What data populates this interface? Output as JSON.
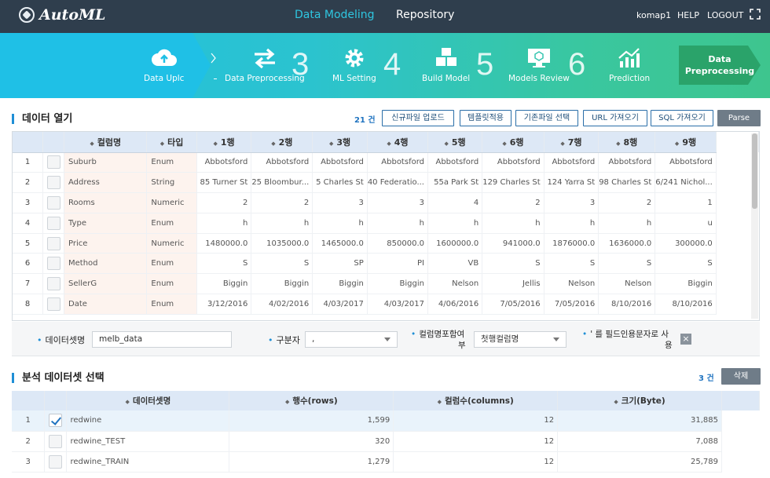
{
  "app": {
    "title": "AutoML"
  },
  "topnav": {
    "active": "Data Modeling",
    "repository": "Repository"
  },
  "user": {
    "name": "komap1",
    "help": "HELP",
    "logout": "LOGOUT"
  },
  "steps": [
    {
      "label": "Data Uplc",
      "num": ""
    },
    {
      "label": "Data Preprocessing",
      "num": "3"
    },
    {
      "label": "ML Setting",
      "num": "4"
    },
    {
      "label": "Build Model",
      "num": "5"
    },
    {
      "label": "Models Review",
      "num": "6"
    },
    {
      "label": "Prediction",
      "num": ""
    }
  ],
  "current_step": {
    "line1": "Data",
    "line2": "Preprocessing"
  },
  "data_open": {
    "title": "데이터 열기",
    "count": "21 건",
    "buttons": [
      "신규파일 업로드",
      "템플릿적용",
      "기존파일 선택",
      "URL 가져오기",
      "SQL 가져오기"
    ],
    "parse": "Parse",
    "headers": [
      "컬럼명",
      "타입",
      "1행",
      "2행",
      "3행",
      "4행",
      "5행",
      "6행",
      "7행",
      "8행",
      "9행"
    ],
    "rows": [
      {
        "no": "1",
        "name": "Suburb",
        "type": "Enum",
        "values": [
          "Abbotsford",
          "Abbotsford",
          "Abbotsford",
          "Abbotsford",
          "Abbotsford",
          "Abbotsford",
          "Abbotsford",
          "Abbotsford",
          "Abbotsford"
        ]
      },
      {
        "no": "2",
        "name": "Address",
        "type": "String",
        "values": [
          "85 Turner St",
          "25 Bloombur...",
          "5 Charles St",
          "40 Federatio...",
          "55a Park St",
          "129 Charles St",
          "124 Yarra St",
          "98 Charles St",
          "6/241 Nichol..."
        ]
      },
      {
        "no": "3",
        "name": "Rooms",
        "type": "Numeric",
        "values": [
          "2",
          "2",
          "3",
          "3",
          "4",
          "2",
          "3",
          "2",
          "1"
        ]
      },
      {
        "no": "4",
        "name": "Type",
        "type": "Enum",
        "values": [
          "h",
          "h",
          "h",
          "h",
          "h",
          "h",
          "h",
          "h",
          "u"
        ]
      },
      {
        "no": "5",
        "name": "Price",
        "type": "Numeric",
        "values": [
          "1480000.0",
          "1035000.0",
          "1465000.0",
          "850000.0",
          "1600000.0",
          "941000.0",
          "1876000.0",
          "1636000.0",
          "300000.0"
        ]
      },
      {
        "no": "6",
        "name": "Method",
        "type": "Enum",
        "values": [
          "S",
          "S",
          "SP",
          "PI",
          "VB",
          "S",
          "S",
          "S",
          "S"
        ]
      },
      {
        "no": "7",
        "name": "SellerG",
        "type": "Enum",
        "values": [
          "Biggin",
          "Biggin",
          "Biggin",
          "Biggin",
          "Nelson",
          "Jellis",
          "Nelson",
          "Nelson",
          "Biggin"
        ]
      },
      {
        "no": "8",
        "name": "Date",
        "type": "Enum",
        "values": [
          "3/12/2016",
          "4/02/2016",
          "4/03/2017",
          "4/03/2017",
          "4/06/2016",
          "7/05/2016",
          "7/05/2016",
          "8/10/2016",
          "8/10/2016"
        ]
      }
    ]
  },
  "options": {
    "dataset_label": "데이터셋명",
    "dataset_value": "melb_data",
    "delimiter_label": "구분자",
    "delimiter_value": ",",
    "header_label_1": "컬럼명포함여",
    "header_label_2": "부",
    "header_value": "첫행컬럼명",
    "quote_label_1": "' 를 필드인용문자로 사",
    "quote_label_2": "용",
    "quote_remove": "×"
  },
  "analysis": {
    "title": "분석 데이터셋 선택",
    "count": "3 건",
    "delete": "삭제",
    "headers": [
      "데이터셋명",
      "행수(rows)",
      "컬럼수(columns)",
      "크기(Byte)"
    ],
    "rows": [
      {
        "no": "1",
        "name": "redwine",
        "rows": "1,599",
        "cols": "12",
        "size": "31,885",
        "checked": true
      },
      {
        "no": "2",
        "name": "redwine_TEST",
        "rows": "320",
        "cols": "12",
        "size": "7,088",
        "checked": false
      },
      {
        "no": "3",
        "name": "redwine_TRAIN",
        "rows": "1,279",
        "cols": "12",
        "size": "25,789",
        "checked": false
      }
    ]
  }
}
